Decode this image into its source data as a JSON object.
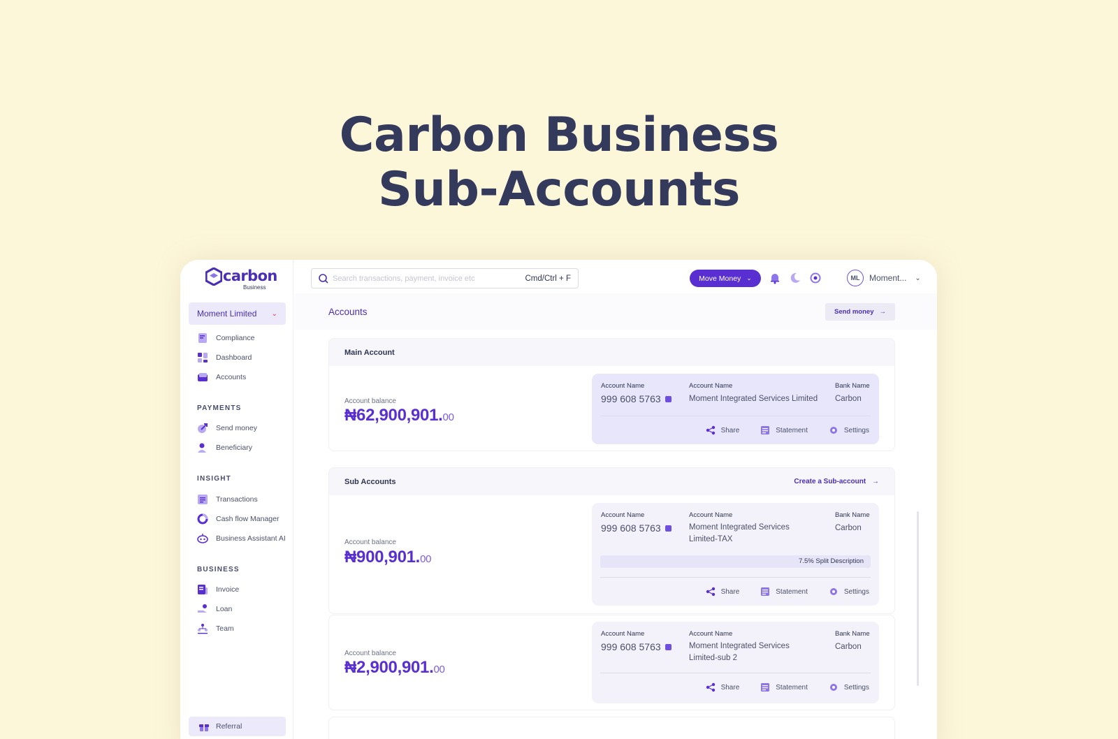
{
  "hero": {
    "line1": "Carbon Business",
    "line2": "Sub-Accounts"
  },
  "brand": {
    "name": "carbon",
    "sub": "Business",
    "accent": "#5a2fd1"
  },
  "org_selector": {
    "value": "Moment Limited"
  },
  "nav": {
    "top": [
      {
        "label": "Compliance",
        "icon": "compliance-icon"
      },
      {
        "label": "Dashboard",
        "icon": "dashboard-icon"
      },
      {
        "label": "Accounts",
        "icon": "accounts-icon"
      }
    ],
    "payments_title": "PAYMENTS",
    "payments": [
      {
        "label": "Send money",
        "icon": "send-money-icon"
      },
      {
        "label": "Beneficiary",
        "icon": "beneficiary-icon"
      }
    ],
    "insight_title": "INSIGHT",
    "insight": [
      {
        "label": "Transactions",
        "icon": "transactions-icon"
      },
      {
        "label": "Cash flow Manager",
        "icon": "cash-flow-icon"
      },
      {
        "label": "Business Assistant AI",
        "icon": "assistant-icon"
      }
    ],
    "business_title": "BUSINESS",
    "business": [
      {
        "label": "Invoice",
        "icon": "invoice-icon"
      },
      {
        "label": "Loan",
        "icon": "loan-icon"
      },
      {
        "label": "Team",
        "icon": "team-icon"
      }
    ],
    "referral": "Referral"
  },
  "topbar": {
    "search_placeholder": "Search transactions, payment, invoice etc",
    "shortcut": "Cmd/Ctrl + F",
    "move_money": "Move Money",
    "user_initials": "ML",
    "user_name": "Moment..."
  },
  "page": {
    "title": "Accounts",
    "send_money": "Send money"
  },
  "main_account": {
    "section_title": "Main Account",
    "balance_label": "Account balance",
    "balance_whole": "₦62,900,901.",
    "balance_cents": "00",
    "acct_number_label": "Account Name",
    "acct_number": "999 608 5763",
    "acct_name_label": "Account Name",
    "acct_name": "Moment Integrated Services Limited",
    "bank_label": "Bank Name",
    "bank": "Carbon"
  },
  "sub_accounts": {
    "section_title": "Sub Accounts",
    "create_link": "Create a Sub-account",
    "items": [
      {
        "balance_label": "Account balance",
        "balance_whole": "₦900,901.",
        "balance_cents": "00",
        "acct_number_label": "Account Name",
        "acct_number": "999 608 5763",
        "acct_name_label": "Account Name",
        "acct_name_1": "Moment Integrated Services",
        "acct_name_2": "Limited-TAX",
        "bank_label": "Bank Name",
        "bank": "Carbon",
        "split": "7.5% Split Description"
      },
      {
        "balance_label": "Account balance",
        "balance_whole": "₦2,900,901.",
        "balance_cents": "00",
        "acct_number_label": "Account Name",
        "acct_number": "999 608 5763",
        "acct_name_label": "Account Name",
        "acct_name_1": "Moment Integrated Services",
        "acct_name_2": "Limited-sub 2",
        "bank_label": "Bank Name",
        "bank": "Carbon"
      }
    ]
  },
  "actions": {
    "share": "Share",
    "statement": "Statement",
    "settings": "Settings"
  }
}
